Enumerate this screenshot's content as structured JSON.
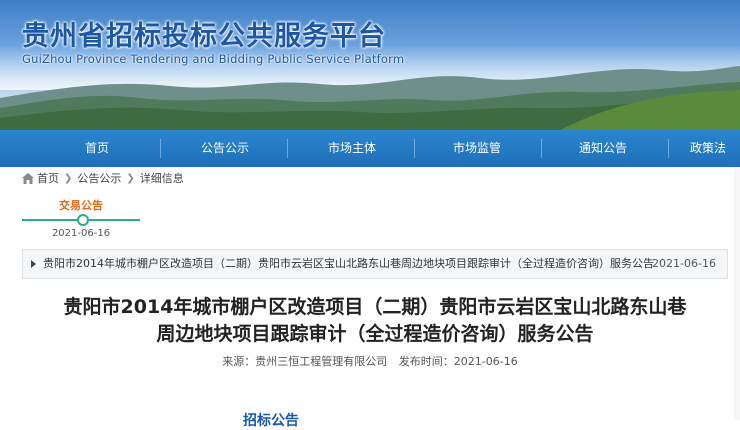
{
  "banner": {
    "title": "贵州省招标投标公共服务平台",
    "subtitle": "GuiZhou Province Tendering and Bidding Public Service Platform"
  },
  "nav": {
    "items": [
      "首页",
      "公告公示",
      "市场主体",
      "市场监管",
      "通知公告",
      "政策法"
    ]
  },
  "breadcrumb": {
    "home": "首页",
    "level1": "公告公示",
    "level2": "详细信息"
  },
  "timeline": {
    "label": "交易公告",
    "date": "2021-06-16"
  },
  "announcement": {
    "text": "贵阳市2014年城市棚户区改造项目（二期）贵阳市云岩区宝山北路东山巷周边地块项目跟踪审计（全过程造价咨询）服务公告",
    "date": "2021-06-16"
  },
  "article": {
    "title_line1": "贵阳市2014年城市棚户区改造项目（二期）贵阳市云岩区宝山北路东山巷",
    "title_line2": "周边地块项目跟踪审计（全过程造价咨询）服务公告",
    "source": "来源：贵州三恒工程管理有限公司",
    "published": "发布时间：2021-06-16",
    "section_cut": "招标公告"
  },
  "colors": {
    "brand_blue": "#1b56a8",
    "nav_blue": "#1f6fb9",
    "timeline_green": "#27b089",
    "timeline_label": "#e06a16"
  }
}
